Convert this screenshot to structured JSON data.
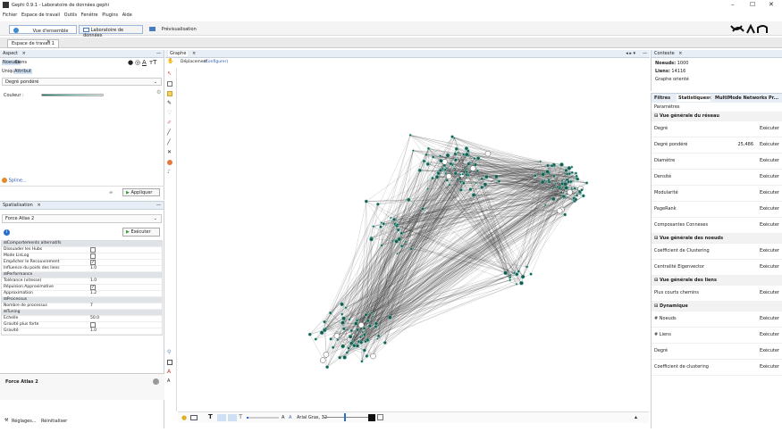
{
  "window": {
    "title": "Gephi 0.9.1 - Laboratoire de données.gephi",
    "controls": [
      "–",
      "☐",
      "✕"
    ]
  },
  "menu": [
    "Fichier",
    "Espace de travail",
    "Outils",
    "Fenêtre",
    "Plugins",
    "Aide"
  ],
  "toolbar": {
    "tabs": [
      "Vue d'ensemble",
      "Laboratoire de données",
      "Prévisualisation"
    ]
  },
  "workspace_tab": "Espace de travail 1",
  "aspect": {
    "title": "Aspect",
    "subtabs": [
      "Noeuds",
      "Liens"
    ],
    "modes": [
      "Unique",
      "Attribut"
    ],
    "attribute": "Degré pondéré",
    "color_label": "Couleur :",
    "spline": "Spline...",
    "apply": "Appliquer"
  },
  "spatialisation": {
    "title": "Spatialisation",
    "algorithm": "Force Atlas 2",
    "run": "Exécuter",
    "groups": [
      {
        "name": "Comportements alternatifs",
        "rows": [
          {
            "label": "Dissuader les Hubs",
            "value": "",
            "check": false
          },
          {
            "label": "Mode LinLog",
            "value": "",
            "check": false
          },
          {
            "label": "Empêcher le Recouvrement",
            "value": "",
            "check": true
          },
          {
            "label": "Influence du poids des liens",
            "value": "1.0"
          }
        ]
      },
      {
        "name": "Performance",
        "rows": [
          {
            "label": "Tolérance (vitesse)",
            "value": "1.0"
          },
          {
            "label": "Répulsion Approximative",
            "value": "",
            "check": true
          },
          {
            "label": "Approximation",
            "value": "1.2"
          }
        ]
      },
      {
        "name": "Processus",
        "rows": [
          {
            "label": "Nombre de processus",
            "value": "7"
          }
        ]
      },
      {
        "name": "Tuning",
        "rows": [
          {
            "label": "Echelle",
            "value": "50.0"
          },
          {
            "label": "Gravité plus forte",
            "value": "",
            "check": false
          },
          {
            "label": "Gravité",
            "value": "1.0"
          }
        ]
      }
    ],
    "description_title": "Force Atlas 2",
    "footer": [
      "Réglages...",
      "Réinitialiser"
    ]
  },
  "graph": {
    "tab": "Graphe",
    "mode": "Déplacement",
    "configure": "(Configurer)",
    "font_label": "Arial Gras, 32",
    "font_a1": "A",
    "font_a2": "A",
    "colors": {
      "node": "#1d5a4f",
      "edge": "#1a1a1a",
      "node_halo": "#7fd6c9"
    }
  },
  "context": {
    "title": "Contexte",
    "nodes_label": "Noeuds:",
    "nodes_value": "1000",
    "edges_label": "Liens:",
    "edges_value": "14116",
    "graph_type": "Graphe orienté"
  },
  "stats": {
    "tabs": [
      "Filtres",
      "Statistiques",
      "MultiMode Networks Pr..."
    ],
    "params": "Paramètres",
    "sections": [
      {
        "title": "Vue générale du réseau",
        "rows": [
          {
            "label": "Degré",
            "value": "",
            "action": "Exécuter"
          },
          {
            "label": "Degré pondéré",
            "value": "25,486",
            "action": "Exécuter"
          },
          {
            "label": "Diamètre",
            "value": "",
            "action": "Exécuter"
          },
          {
            "label": "Densité",
            "value": "",
            "action": "Exécuter"
          },
          {
            "label": "Modularité",
            "value": "",
            "action": "Exécuter"
          },
          {
            "label": "PageRank",
            "value": "",
            "action": "Exécuter"
          },
          {
            "label": "Composantes Connexes",
            "value": "",
            "action": "Exécuter"
          }
        ]
      },
      {
        "title": "Vue générale des noeuds",
        "rows": [
          {
            "label": "Coefficient de Clustering",
            "value": "",
            "action": "Exécuter"
          },
          {
            "label": "Centralité Eigenvector",
            "value": "",
            "action": "Exécuter"
          }
        ]
      },
      {
        "title": "Vue générale des liens",
        "rows": [
          {
            "label": "Plus courts chemins",
            "value": "",
            "action": "Exécuter"
          }
        ]
      },
      {
        "title": "Dynamique",
        "rows": [
          {
            "label": "# Noeuds",
            "value": "",
            "action": "Exécuter"
          },
          {
            "label": "# Liens",
            "value": "",
            "action": "Exécuter"
          },
          {
            "label": "Degré",
            "value": "",
            "action": "Exécuter"
          },
          {
            "label": "Coefficient de clustering",
            "value": "",
            "action": "Exécuter"
          }
        ]
      }
    ]
  }
}
